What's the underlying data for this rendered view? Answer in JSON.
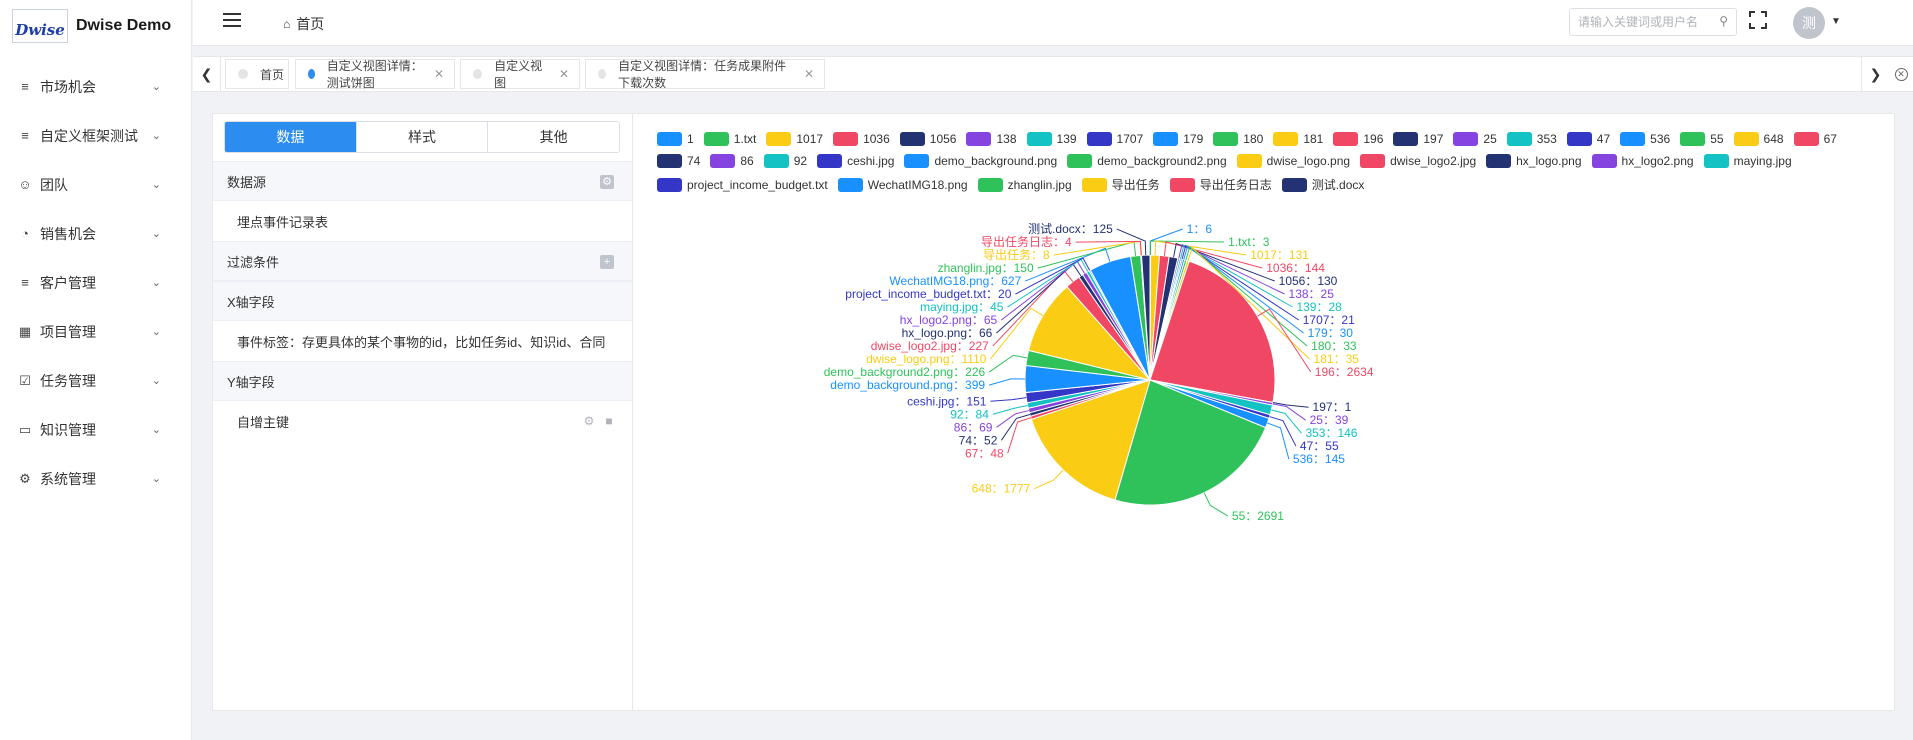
{
  "app": {
    "logo_text": "Dwise",
    "title": "Dwise Demo"
  },
  "sidebar": {
    "items": [
      {
        "label": "市场机会",
        "icon": "list-icon"
      },
      {
        "label": "自定义框架测试",
        "icon": "list-icon"
      },
      {
        "label": "团队",
        "icon": "team-icon"
      },
      {
        "label": "销售机会",
        "icon": "pie-icon"
      },
      {
        "label": "客户管理",
        "icon": "list-icon"
      },
      {
        "label": "项目管理",
        "icon": "grid-icon"
      },
      {
        "label": "任务管理",
        "icon": "calendar-check-icon"
      },
      {
        "label": "知识管理",
        "icon": "book-icon"
      },
      {
        "label": "系统管理",
        "icon": "gear-icon"
      }
    ]
  },
  "header": {
    "breadcrumb": "首页",
    "search_placeholder": "请输入关键词或用户名",
    "avatar_text": "测"
  },
  "tabs": [
    {
      "label": "首页",
      "active": false,
      "closable": false
    },
    {
      "label": "自定义视图详情：测试饼图",
      "active": true,
      "closable": true
    },
    {
      "label": "自定义视图",
      "active": false,
      "closable": true
    },
    {
      "label": "自定义视图详情：任务成果附件下载次数",
      "active": false,
      "closable": true
    }
  ],
  "config_panel": {
    "tabs": [
      "数据",
      "样式",
      "其他"
    ],
    "active_tab": "数据",
    "sections": {
      "datasource": {
        "title": "数据源",
        "value": "埋点事件记录表"
      },
      "filter": {
        "title": "过滤条件"
      },
      "x_field": {
        "title": "X轴字段",
        "value": "事件标签：存更具体的某个事物的id，比如任务id、知识id、合同"
      },
      "y_field": {
        "title": "Y轴字段",
        "value": "自增主键"
      }
    }
  },
  "chart_data": {
    "type": "pie",
    "title": "",
    "legend_position": "top",
    "label_separator": "：",
    "series": [
      {
        "name": "1",
        "value": 6,
        "color": "#1890ff"
      },
      {
        "name": "1.txt",
        "value": 3,
        "color": "#2fc25b"
      },
      {
        "name": "1017",
        "value": 131,
        "color": "#facc14"
      },
      {
        "name": "1036",
        "value": 144,
        "color": "#f04864"
      },
      {
        "name": "1056",
        "value": 130,
        "color": "#223273"
      },
      {
        "name": "138",
        "value": 25,
        "color": "#8543e0"
      },
      {
        "name": "139",
        "value": 28,
        "color": "#13c2c2"
      },
      {
        "name": "1707",
        "value": 21,
        "color": "#3436c7"
      },
      {
        "name": "179",
        "value": 30,
        "color": "#1890ff"
      },
      {
        "name": "180",
        "value": 33,
        "color": "#2fc25b"
      },
      {
        "name": "181",
        "value": 35,
        "color": "#facc14"
      },
      {
        "name": "196",
        "value": 2634,
        "color": "#f04864"
      },
      {
        "name": "197",
        "value": 1,
        "color": "#223273"
      },
      {
        "name": "25",
        "value": 39,
        "color": "#8543e0"
      },
      {
        "name": "353",
        "value": 146,
        "color": "#13c2c2"
      },
      {
        "name": "47",
        "value": 55,
        "color": "#3436c7"
      },
      {
        "name": "536",
        "value": 145,
        "color": "#1890ff"
      },
      {
        "name": "55",
        "value": 2691,
        "color": "#2fc25b"
      },
      {
        "name": "648",
        "value": 1777,
        "color": "#facc14"
      },
      {
        "name": "67",
        "value": 48,
        "color": "#f04864"
      },
      {
        "name": "74",
        "value": 52,
        "color": "#223273"
      },
      {
        "name": "86",
        "value": 69,
        "color": "#8543e0"
      },
      {
        "name": "92",
        "value": 84,
        "color": "#13c2c2"
      },
      {
        "name": "ceshi.jpg",
        "value": 151,
        "color": "#3436c7"
      },
      {
        "name": "demo_background.png",
        "value": 399,
        "color": "#1890ff"
      },
      {
        "name": "demo_background2.png",
        "value": 226,
        "color": "#2fc25b"
      },
      {
        "name": "dwise_logo.png",
        "value": 1110,
        "color": "#facc14"
      },
      {
        "name": "dwise_logo2.jpg",
        "value": 227,
        "color": "#f04864"
      },
      {
        "name": "hx_logo.png",
        "value": 66,
        "color": "#223273"
      },
      {
        "name": "hx_logo2.png",
        "value": 65,
        "color": "#8543e0"
      },
      {
        "name": "maying.jpg",
        "value": 45,
        "color": "#13c2c2"
      },
      {
        "name": "project_income_budget.txt",
        "value": 20,
        "color": "#3436c7"
      },
      {
        "name": "WechatIMG18.png",
        "value": 627,
        "color": "#1890ff"
      },
      {
        "name": "zhanglin.jpg",
        "value": 150,
        "color": "#2fc25b"
      },
      {
        "name": "导出任务",
        "value": 8,
        "color": "#facc14"
      },
      {
        "name": "导出任务日志",
        "value": 4,
        "color": "#f04864"
      },
      {
        "name": "测试.docx",
        "value": 125,
        "color": "#223273"
      }
    ]
  }
}
